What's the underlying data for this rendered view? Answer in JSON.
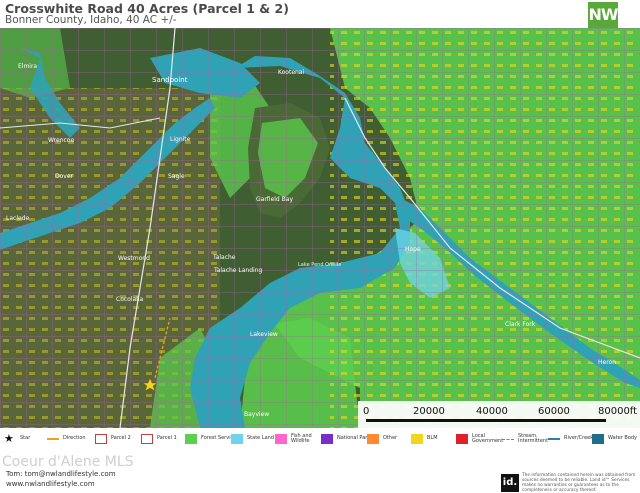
{
  "header": {
    "title": "Crosswhite Road 40 Acres (Parcel 1 & 2)",
    "subtitle": "Bonner County, Idaho, 40 AC +/-",
    "logo_text": "NW"
  },
  "map": {
    "place_labels": {
      "sandpoint": "Sandpoint",
      "kootenai": "Kootenai",
      "wrencoe": "Wrencoe",
      "laclede": "Laclede",
      "dover": "Dover",
      "sagle": "Sagle",
      "lignite": "Lignite",
      "westmond": "Westmond",
      "garfield_bay": "Garfield Bay",
      "hope": "Hope",
      "clark_fork": "Clark Fork",
      "cocolalla": "Cocolalla",
      "talache": "Talache",
      "talache_landing": "Talache Landing",
      "lakeview": "Lakeview",
      "bayview": "Bayview",
      "elmira": "Elmira",
      "heron": "Heron",
      "lake_pend_oreille": "Lake Pend Oreille"
    },
    "colors": {
      "water": "#2fa3b5",
      "forest": "#5ccf4e",
      "state_land": "#6fd4e9",
      "parcel_grid": "#b05aa8",
      "bureau_land": "#f2d61e",
      "terrain": "#3f5f33"
    }
  },
  "scale": {
    "ticks": [
      "0",
      "20000",
      "40000",
      "60000"
    ],
    "unit": "80000ft"
  },
  "legend": [
    {
      "label": "Star",
      "color": "#111111",
      "icon": "star-icon"
    },
    {
      "label": "Direction",
      "color": "#f0a020",
      "icon": "arrow-icon"
    },
    {
      "label": "Parcel 2",
      "color": "#c04040",
      "icon": "parcel-outline-icon"
    },
    {
      "label": "Parcel 1",
      "color": "#c04040",
      "icon": "parcel-outline-icon"
    },
    {
      "label": "Forest Servic",
      "color": "#5ccf4e",
      "icon": "swatch-icon"
    },
    {
      "label": "State Land",
      "color": "#6fd4e9",
      "icon": "swatch-icon"
    },
    {
      "label": "Fish and\nWildlife",
      "color": "#ff66cc",
      "icon": "swatch-icon"
    },
    {
      "label": "National Park",
      "color": "#7a2ec8",
      "icon": "swatch-icon"
    },
    {
      "label": "Other",
      "color": "#ff8a30",
      "icon": "swatch-icon"
    },
    {
      "label": "BLM",
      "color": "#f2d61e",
      "icon": "swatch-icon"
    },
    {
      "label": "Local\nGovernment",
      "color": "#e0202a",
      "icon": "swatch-icon"
    },
    {
      "label": "Stream,\nIntermittent",
      "color": "#4a8fb5",
      "icon": "dashed-line-icon"
    },
    {
      "label": "River/Creek",
      "color": "#2f7fb0",
      "icon": "line-icon"
    },
    {
      "label": "Water Body",
      "color": "#1f6f8a",
      "icon": "swatch-icon"
    }
  ],
  "footer": {
    "watermark": "Coeur d'Alene MLS",
    "agent": "Tom: tom@nwlandlifestyle.com",
    "website": "www.nwlandlifestyle.com",
    "id_logo": "id.",
    "disclaimer": "The information contained herein was obtained from sources deemed to be reliable. Land id™ Services makes no warranties or guarantees as to the completeness or accuracy thereof."
  }
}
